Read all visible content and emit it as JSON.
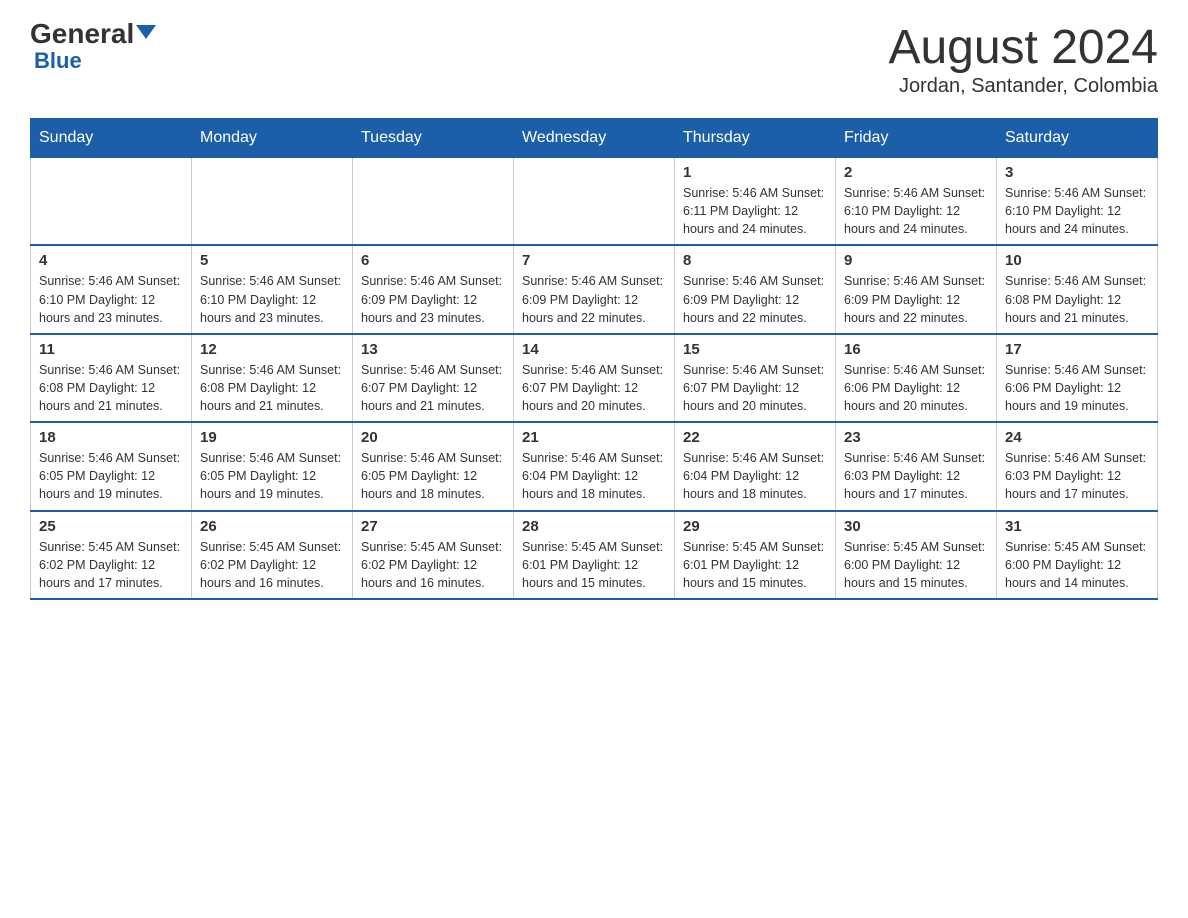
{
  "header": {
    "logo_general": "General",
    "logo_blue": "Blue",
    "month_title": "August 2024",
    "location": "Jordan, Santander, Colombia"
  },
  "days_of_week": [
    "Sunday",
    "Monday",
    "Tuesday",
    "Wednesday",
    "Thursday",
    "Friday",
    "Saturday"
  ],
  "weeks": [
    [
      {
        "day": "",
        "info": ""
      },
      {
        "day": "",
        "info": ""
      },
      {
        "day": "",
        "info": ""
      },
      {
        "day": "",
        "info": ""
      },
      {
        "day": "1",
        "info": "Sunrise: 5:46 AM\nSunset: 6:11 PM\nDaylight: 12 hours and 24 minutes."
      },
      {
        "day": "2",
        "info": "Sunrise: 5:46 AM\nSunset: 6:10 PM\nDaylight: 12 hours and 24 minutes."
      },
      {
        "day": "3",
        "info": "Sunrise: 5:46 AM\nSunset: 6:10 PM\nDaylight: 12 hours and 24 minutes."
      }
    ],
    [
      {
        "day": "4",
        "info": "Sunrise: 5:46 AM\nSunset: 6:10 PM\nDaylight: 12 hours and 23 minutes."
      },
      {
        "day": "5",
        "info": "Sunrise: 5:46 AM\nSunset: 6:10 PM\nDaylight: 12 hours and 23 minutes."
      },
      {
        "day": "6",
        "info": "Sunrise: 5:46 AM\nSunset: 6:09 PM\nDaylight: 12 hours and 23 minutes."
      },
      {
        "day": "7",
        "info": "Sunrise: 5:46 AM\nSunset: 6:09 PM\nDaylight: 12 hours and 22 minutes."
      },
      {
        "day": "8",
        "info": "Sunrise: 5:46 AM\nSunset: 6:09 PM\nDaylight: 12 hours and 22 minutes."
      },
      {
        "day": "9",
        "info": "Sunrise: 5:46 AM\nSunset: 6:09 PM\nDaylight: 12 hours and 22 minutes."
      },
      {
        "day": "10",
        "info": "Sunrise: 5:46 AM\nSunset: 6:08 PM\nDaylight: 12 hours and 21 minutes."
      }
    ],
    [
      {
        "day": "11",
        "info": "Sunrise: 5:46 AM\nSunset: 6:08 PM\nDaylight: 12 hours and 21 minutes."
      },
      {
        "day": "12",
        "info": "Sunrise: 5:46 AM\nSunset: 6:08 PM\nDaylight: 12 hours and 21 minutes."
      },
      {
        "day": "13",
        "info": "Sunrise: 5:46 AM\nSunset: 6:07 PM\nDaylight: 12 hours and 21 minutes."
      },
      {
        "day": "14",
        "info": "Sunrise: 5:46 AM\nSunset: 6:07 PM\nDaylight: 12 hours and 20 minutes."
      },
      {
        "day": "15",
        "info": "Sunrise: 5:46 AM\nSunset: 6:07 PM\nDaylight: 12 hours and 20 minutes."
      },
      {
        "day": "16",
        "info": "Sunrise: 5:46 AM\nSunset: 6:06 PM\nDaylight: 12 hours and 20 minutes."
      },
      {
        "day": "17",
        "info": "Sunrise: 5:46 AM\nSunset: 6:06 PM\nDaylight: 12 hours and 19 minutes."
      }
    ],
    [
      {
        "day": "18",
        "info": "Sunrise: 5:46 AM\nSunset: 6:05 PM\nDaylight: 12 hours and 19 minutes."
      },
      {
        "day": "19",
        "info": "Sunrise: 5:46 AM\nSunset: 6:05 PM\nDaylight: 12 hours and 19 minutes."
      },
      {
        "day": "20",
        "info": "Sunrise: 5:46 AM\nSunset: 6:05 PM\nDaylight: 12 hours and 18 minutes."
      },
      {
        "day": "21",
        "info": "Sunrise: 5:46 AM\nSunset: 6:04 PM\nDaylight: 12 hours and 18 minutes."
      },
      {
        "day": "22",
        "info": "Sunrise: 5:46 AM\nSunset: 6:04 PM\nDaylight: 12 hours and 18 minutes."
      },
      {
        "day": "23",
        "info": "Sunrise: 5:46 AM\nSunset: 6:03 PM\nDaylight: 12 hours and 17 minutes."
      },
      {
        "day": "24",
        "info": "Sunrise: 5:46 AM\nSunset: 6:03 PM\nDaylight: 12 hours and 17 minutes."
      }
    ],
    [
      {
        "day": "25",
        "info": "Sunrise: 5:45 AM\nSunset: 6:02 PM\nDaylight: 12 hours and 17 minutes."
      },
      {
        "day": "26",
        "info": "Sunrise: 5:45 AM\nSunset: 6:02 PM\nDaylight: 12 hours and 16 minutes."
      },
      {
        "day": "27",
        "info": "Sunrise: 5:45 AM\nSunset: 6:02 PM\nDaylight: 12 hours and 16 minutes."
      },
      {
        "day": "28",
        "info": "Sunrise: 5:45 AM\nSunset: 6:01 PM\nDaylight: 12 hours and 15 minutes."
      },
      {
        "day": "29",
        "info": "Sunrise: 5:45 AM\nSunset: 6:01 PM\nDaylight: 12 hours and 15 minutes."
      },
      {
        "day": "30",
        "info": "Sunrise: 5:45 AM\nSunset: 6:00 PM\nDaylight: 12 hours and 15 minutes."
      },
      {
        "day": "31",
        "info": "Sunrise: 5:45 AM\nSunset: 6:00 PM\nDaylight: 12 hours and 14 minutes."
      }
    ]
  ]
}
